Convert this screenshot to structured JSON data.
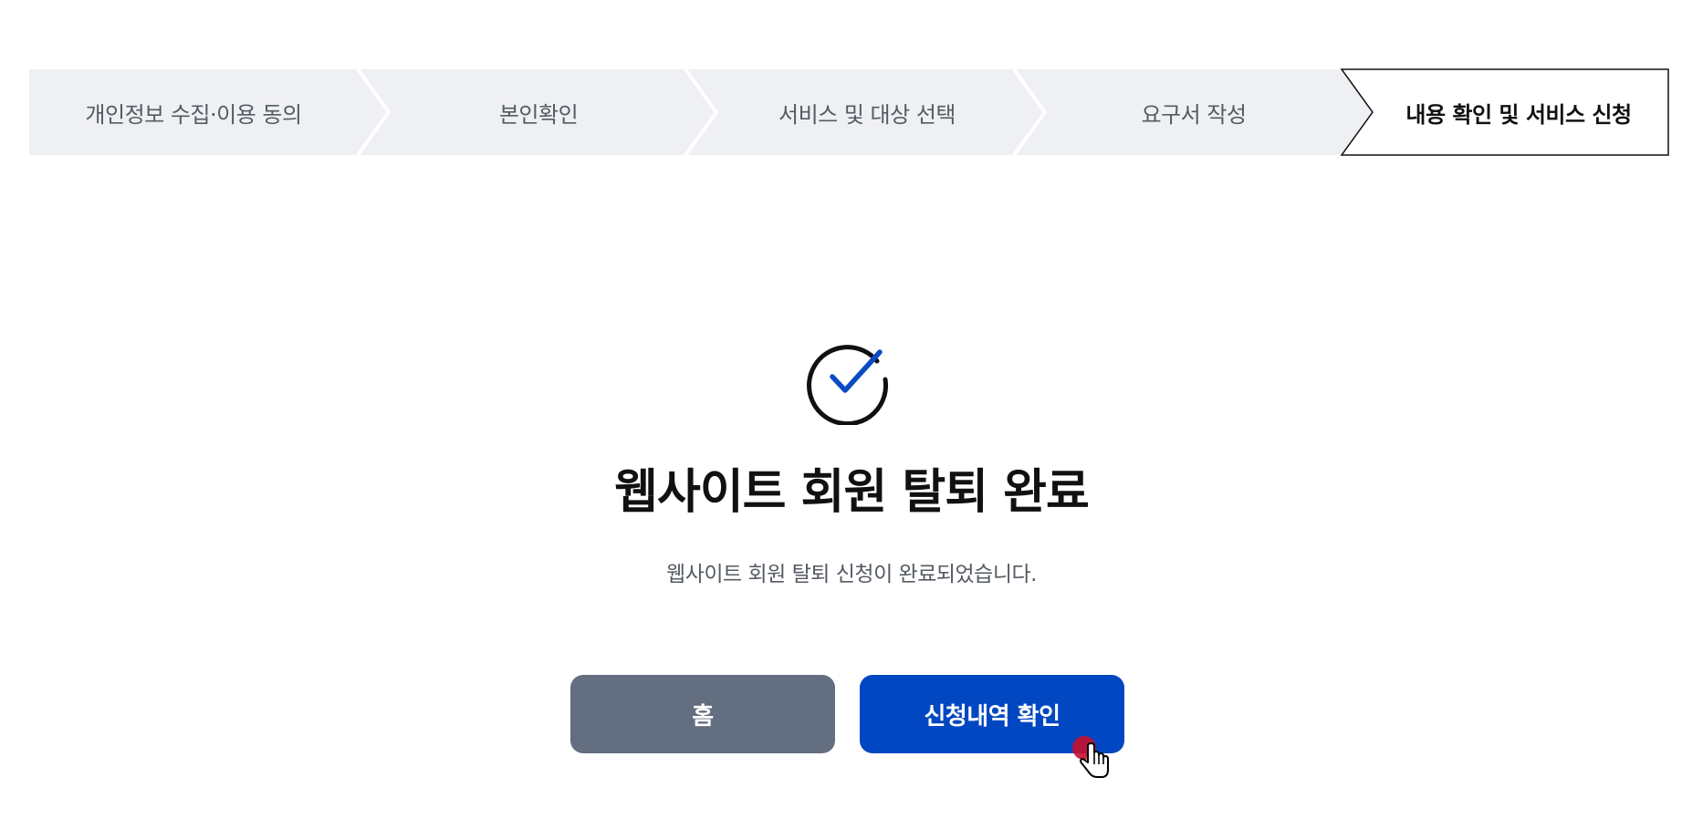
{
  "stepper": {
    "steps": [
      {
        "label": "개인정보 수집·이용 동의",
        "active": false
      },
      {
        "label": "본인확인",
        "active": false
      },
      {
        "label": "서비스 및 대상 선택",
        "active": false
      },
      {
        "label": "요구서 작성",
        "active": false
      },
      {
        "label": "내용 확인 및 서비스 신청",
        "active": true
      }
    ],
    "colors": {
      "inactive_bg": "#eff0f3",
      "active_bg": "#ffffff",
      "active_border": "#111111"
    }
  },
  "result": {
    "icon": "check-circle-icon",
    "title": "웹사이트 회원 탈퇴 완료",
    "description": "웹사이트 회원 탈퇴 신청이 완료되었습니다."
  },
  "buttons": {
    "home_label": "홈",
    "history_label": "신청내역 확인"
  },
  "colors": {
    "accent": "#0247c2",
    "secondary": "#636e80",
    "check": "#0a4bc4"
  }
}
